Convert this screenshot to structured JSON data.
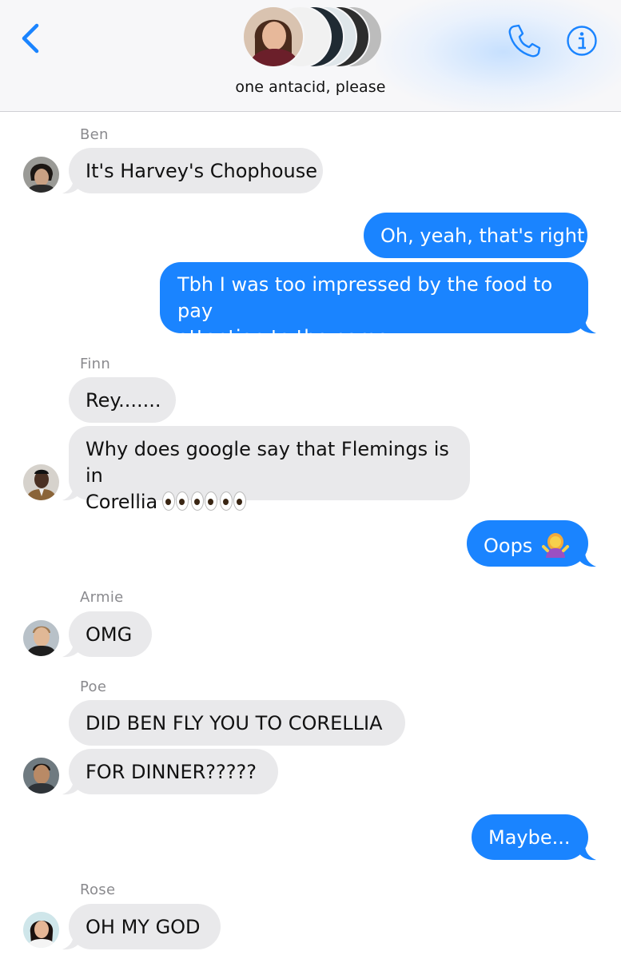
{
  "header": {
    "group_name": "one antacid, please"
  },
  "messages": [
    {
      "sender": "Ben"
    },
    {
      "text": "It's Harvey's Chophouse"
    },
    {
      "text": "Oh, yeah, that's right"
    },
    {
      "line1": "Tbh I was too impressed by the food to pay",
      "line2": "attention to the name"
    },
    {
      "sender": "Finn"
    },
    {
      "text": "Rey......."
    },
    {
      "line1": "Why does google say that Flemings is in",
      "line2": "Corellia"
    },
    {
      "text": "Oops"
    },
    {
      "sender": "Armie"
    },
    {
      "text": "OMG"
    },
    {
      "sender": "Poe"
    },
    {
      "text": "DID BEN FLY YOU TO CORELLIA"
    },
    {
      "text": "FOR DINNER?????"
    },
    {
      "text": "Maybe..."
    },
    {
      "sender": "Rose"
    },
    {
      "text": "OH MY GOD"
    }
  ],
  "icons": {
    "back": "chevron-left-icon",
    "call": "phone-icon",
    "info": "info-icon",
    "eyes": "eyes-emoji",
    "shrug": "person-shrugging-emoji"
  },
  "colors": {
    "accent": "#1a84ff",
    "incoming_bubble": "#e9e9eb",
    "sender_label": "#8a8a8e"
  }
}
